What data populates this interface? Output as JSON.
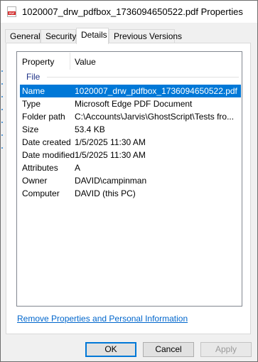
{
  "window": {
    "title": "1020007_drw_pdfbox_1736094650522.pdf Properties",
    "icon": "pdf-file-icon",
    "icon_label": "PDF"
  },
  "tabs": [
    {
      "label": "General"
    },
    {
      "label": "Security"
    },
    {
      "label": "Details",
      "active": true
    },
    {
      "label": "Previous Versions"
    }
  ],
  "details": {
    "column_property": "Property",
    "column_value": "Value",
    "group": "File",
    "rows": [
      {
        "property": "Name",
        "value": "1020007_drw_pdfbox_1736094650522.pdf",
        "selected": true
      },
      {
        "property": "Type",
        "value": "Microsoft Edge PDF Document"
      },
      {
        "property": "Folder path",
        "value": "C:\\Accounts\\Jarvis\\GhostScript\\Tests fro..."
      },
      {
        "property": "Size",
        "value": "53.4 KB"
      },
      {
        "property": "Date created",
        "value": "1/5/2025 11:30 AM"
      },
      {
        "property": "Date modified",
        "value": "1/5/2025 11:30 AM"
      },
      {
        "property": "Attributes",
        "value": "A"
      },
      {
        "property": "Owner",
        "value": "DAVID\\campinman"
      },
      {
        "property": "Computer",
        "value": "DAVID (this PC)"
      }
    ],
    "remove_link": "Remove Properties and Personal Information"
  },
  "buttons": {
    "ok": "OK",
    "cancel": "Cancel",
    "apply": "Apply"
  },
  "colors": {
    "selection": "#0078d7",
    "group_label": "#1e3287",
    "link": "#0066cc"
  }
}
